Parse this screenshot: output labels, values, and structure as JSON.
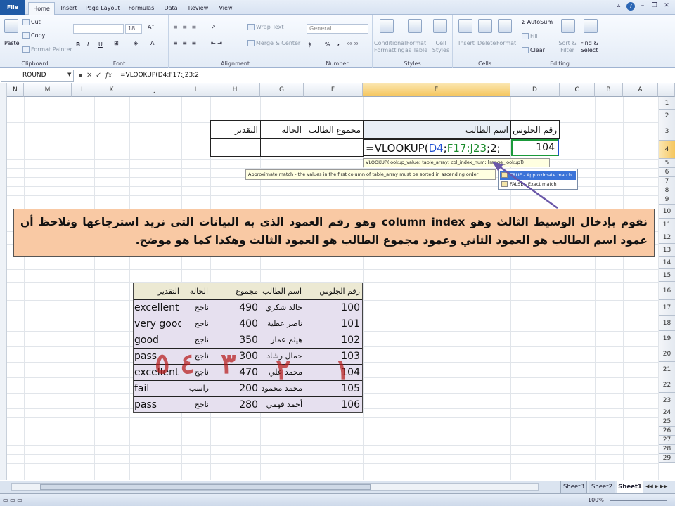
{
  "ribbon": {
    "tabs": [
      "File",
      "Home",
      "Insert",
      "Page Layout",
      "Formulas",
      "Data",
      "Review",
      "View"
    ],
    "active_tab": "Home",
    "clipboard": {
      "paste": "Paste",
      "cut": "Cut",
      "copy": "Copy",
      "format_painter": "Format Painter",
      "label": "Clipboard"
    },
    "font": {
      "size": "18",
      "bold": "B",
      "italic": "I",
      "underline": "U",
      "label": "Font"
    },
    "alignment": {
      "wrap_text": "Wrap Text",
      "merge_center": "Merge & Center",
      "label": "Alignment"
    },
    "number": {
      "format": "General",
      "percent": "%",
      "comma": ",",
      "label": "Number"
    },
    "styles": {
      "conditional": "Conditional Formatting",
      "format_table": "Format as Table",
      "cell_styles": "Cell Styles",
      "label": "Styles"
    },
    "cells": {
      "insert": "Insert",
      "delete": "Delete",
      "format": "Format",
      "label": "Cells"
    },
    "editing": {
      "autosum": "AutoSum",
      "fill": "Fill",
      "clear": "Clear",
      "sort_filter": "Sort & Filter",
      "find_select": "Find & Select",
      "label": "Editing"
    }
  },
  "formula_bar": {
    "name_box": "ROUND",
    "formula": "=VLOOKUP(D4;F17:J23;2;"
  },
  "columns": [
    "N",
    "M",
    "L",
    "K",
    "J",
    "I",
    "H",
    "G",
    "F",
    "E",
    "D",
    "C",
    "B",
    "A"
  ],
  "rows": [
    "1",
    "2",
    "3",
    "4",
    "5",
    "6",
    "7",
    "8",
    "9",
    "10",
    "11",
    "12",
    "13",
    "14",
    "15",
    "16",
    "17",
    "18",
    "19",
    "20",
    "21",
    "22",
    "23",
    "24",
    "25",
    "26",
    "27",
    "28",
    "29"
  ],
  "lookup_table": {
    "headers": {
      "seat": "رقم الجلوس",
      "name": "اسم الطالب",
      "total": "مجموع الطالب",
      "status": "الحالة",
      "grade": "التقدير"
    },
    "seat_value": "104",
    "edit_formula": {
      "prefix": "=VLOOKUP(",
      "ref1": "D4",
      "sep1": ";",
      "ref2": "F17:J23",
      "rest": ";2;"
    }
  },
  "tooltips": {
    "args": "VLOOKUP(lookup_value; table_array; col_index_num; [range_lookup])",
    "approx": "Approximate match - the values in the first column of table_array must be sorted in ascending order",
    "options": [
      "TRUE - Approximate match",
      "FALSE - Exact match"
    ]
  },
  "callout": {
    "text": "نقوم بإدخال الوسيط الثالث وهو column index وهو رقم العمود الذى به البيانات التى نريد استرجاعها ونلاحظ أن عمود اسم الطالب هو العمود الثاني وعمود مجموع الطالب هو العمود الثالث وهكذا كما هو موضح."
  },
  "data_table": {
    "headers": {
      "seat": "رقم الجلوس",
      "name": "اسم الطالب",
      "total": "مجموع الطالب",
      "status": "الحالة",
      "grade": "التقدير"
    },
    "rows": [
      {
        "seat": "100",
        "name": "خالد شكري",
        "total": "490",
        "status": "ناجح",
        "grade": "excellent"
      },
      {
        "seat": "101",
        "name": "ناصر عطية",
        "total": "400",
        "status": "ناجح",
        "grade": "very good"
      },
      {
        "seat": "102",
        "name": "هيثم عمار",
        "total": "350",
        "status": "ناجح",
        "grade": "good"
      },
      {
        "seat": "103",
        "name": "جمال رشاد",
        "total": "300",
        "status": "ناجح",
        "grade": "pass"
      },
      {
        "seat": "104",
        "name": "محمد علي",
        "total": "470",
        "status": "ناجح",
        "grade": "excellent"
      },
      {
        "seat": "105",
        "name": "محمد محمود",
        "total": "200",
        "status": "راسب",
        "grade": "fail"
      },
      {
        "seat": "106",
        "name": "أحمد فهمي",
        "total": "280",
        "status": "ناجح",
        "grade": "pass"
      }
    ]
  },
  "annotations": [
    "١",
    "٢",
    "٣",
    "٤",
    "٥"
  ],
  "sheets": [
    "Sheet3",
    "Sheet2",
    "Sheet1"
  ],
  "active_sheet": "Sheet1",
  "status": {
    "zoom": "100%"
  }
}
